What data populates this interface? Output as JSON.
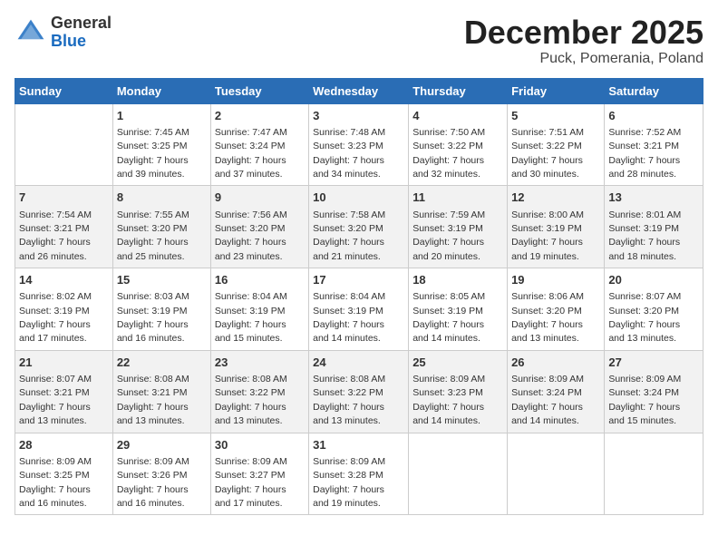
{
  "header": {
    "logo_general": "General",
    "logo_blue": "Blue",
    "title": "December 2025",
    "subtitle": "Puck, Pomerania, Poland"
  },
  "days_of_week": [
    "Sunday",
    "Monday",
    "Tuesday",
    "Wednesday",
    "Thursday",
    "Friday",
    "Saturday"
  ],
  "weeks": [
    [
      {
        "day": "",
        "empty": true
      },
      {
        "day": "1",
        "sunrise": "Sunrise: 7:45 AM",
        "sunset": "Sunset: 3:25 PM",
        "daylight": "Daylight: 7 hours",
        "minutes": "and 39 minutes."
      },
      {
        "day": "2",
        "sunrise": "Sunrise: 7:47 AM",
        "sunset": "Sunset: 3:24 PM",
        "daylight": "Daylight: 7 hours",
        "minutes": "and 37 minutes."
      },
      {
        "day": "3",
        "sunrise": "Sunrise: 7:48 AM",
        "sunset": "Sunset: 3:23 PM",
        "daylight": "Daylight: 7 hours",
        "minutes": "and 34 minutes."
      },
      {
        "day": "4",
        "sunrise": "Sunrise: 7:50 AM",
        "sunset": "Sunset: 3:22 PM",
        "daylight": "Daylight: 7 hours",
        "minutes": "and 32 minutes."
      },
      {
        "day": "5",
        "sunrise": "Sunrise: 7:51 AM",
        "sunset": "Sunset: 3:22 PM",
        "daylight": "Daylight: 7 hours",
        "minutes": "and 30 minutes."
      },
      {
        "day": "6",
        "sunrise": "Sunrise: 7:52 AM",
        "sunset": "Sunset: 3:21 PM",
        "daylight": "Daylight: 7 hours",
        "minutes": "and 28 minutes."
      }
    ],
    [
      {
        "day": "7",
        "sunrise": "Sunrise: 7:54 AM",
        "sunset": "Sunset: 3:21 PM",
        "daylight": "Daylight: 7 hours",
        "minutes": "and 26 minutes."
      },
      {
        "day": "8",
        "sunrise": "Sunrise: 7:55 AM",
        "sunset": "Sunset: 3:20 PM",
        "daylight": "Daylight: 7 hours",
        "minutes": "and 25 minutes."
      },
      {
        "day": "9",
        "sunrise": "Sunrise: 7:56 AM",
        "sunset": "Sunset: 3:20 PM",
        "daylight": "Daylight: 7 hours",
        "minutes": "and 23 minutes."
      },
      {
        "day": "10",
        "sunrise": "Sunrise: 7:58 AM",
        "sunset": "Sunset: 3:20 PM",
        "daylight": "Daylight: 7 hours",
        "minutes": "and 21 minutes."
      },
      {
        "day": "11",
        "sunrise": "Sunrise: 7:59 AM",
        "sunset": "Sunset: 3:19 PM",
        "daylight": "Daylight: 7 hours",
        "minutes": "and 20 minutes."
      },
      {
        "day": "12",
        "sunrise": "Sunrise: 8:00 AM",
        "sunset": "Sunset: 3:19 PM",
        "daylight": "Daylight: 7 hours",
        "minutes": "and 19 minutes."
      },
      {
        "day": "13",
        "sunrise": "Sunrise: 8:01 AM",
        "sunset": "Sunset: 3:19 PM",
        "daylight": "Daylight: 7 hours",
        "minutes": "and 18 minutes."
      }
    ],
    [
      {
        "day": "14",
        "sunrise": "Sunrise: 8:02 AM",
        "sunset": "Sunset: 3:19 PM",
        "daylight": "Daylight: 7 hours",
        "minutes": "and 17 minutes."
      },
      {
        "day": "15",
        "sunrise": "Sunrise: 8:03 AM",
        "sunset": "Sunset: 3:19 PM",
        "daylight": "Daylight: 7 hours",
        "minutes": "and 16 minutes."
      },
      {
        "day": "16",
        "sunrise": "Sunrise: 8:04 AM",
        "sunset": "Sunset: 3:19 PM",
        "daylight": "Daylight: 7 hours",
        "minutes": "and 15 minutes."
      },
      {
        "day": "17",
        "sunrise": "Sunrise: 8:04 AM",
        "sunset": "Sunset: 3:19 PM",
        "daylight": "Daylight: 7 hours",
        "minutes": "and 14 minutes."
      },
      {
        "day": "18",
        "sunrise": "Sunrise: 8:05 AM",
        "sunset": "Sunset: 3:19 PM",
        "daylight": "Daylight: 7 hours",
        "minutes": "and 14 minutes."
      },
      {
        "day": "19",
        "sunrise": "Sunrise: 8:06 AM",
        "sunset": "Sunset: 3:20 PM",
        "daylight": "Daylight: 7 hours",
        "minutes": "and 13 minutes."
      },
      {
        "day": "20",
        "sunrise": "Sunrise: 8:07 AM",
        "sunset": "Sunset: 3:20 PM",
        "daylight": "Daylight: 7 hours",
        "minutes": "and 13 minutes."
      }
    ],
    [
      {
        "day": "21",
        "sunrise": "Sunrise: 8:07 AM",
        "sunset": "Sunset: 3:21 PM",
        "daylight": "Daylight: 7 hours",
        "minutes": "and 13 minutes."
      },
      {
        "day": "22",
        "sunrise": "Sunrise: 8:08 AM",
        "sunset": "Sunset: 3:21 PM",
        "daylight": "Daylight: 7 hours",
        "minutes": "and 13 minutes."
      },
      {
        "day": "23",
        "sunrise": "Sunrise: 8:08 AM",
        "sunset": "Sunset: 3:22 PM",
        "daylight": "Daylight: 7 hours",
        "minutes": "and 13 minutes."
      },
      {
        "day": "24",
        "sunrise": "Sunrise: 8:08 AM",
        "sunset": "Sunset: 3:22 PM",
        "daylight": "Daylight: 7 hours",
        "minutes": "and 13 minutes."
      },
      {
        "day": "25",
        "sunrise": "Sunrise: 8:09 AM",
        "sunset": "Sunset: 3:23 PM",
        "daylight": "Daylight: 7 hours",
        "minutes": "and 14 minutes."
      },
      {
        "day": "26",
        "sunrise": "Sunrise: 8:09 AM",
        "sunset": "Sunset: 3:24 PM",
        "daylight": "Daylight: 7 hours",
        "minutes": "and 14 minutes."
      },
      {
        "day": "27",
        "sunrise": "Sunrise: 8:09 AM",
        "sunset": "Sunset: 3:24 PM",
        "daylight": "Daylight: 7 hours",
        "minutes": "and 15 minutes."
      }
    ],
    [
      {
        "day": "28",
        "sunrise": "Sunrise: 8:09 AM",
        "sunset": "Sunset: 3:25 PM",
        "daylight": "Daylight: 7 hours",
        "minutes": "and 16 minutes."
      },
      {
        "day": "29",
        "sunrise": "Sunrise: 8:09 AM",
        "sunset": "Sunset: 3:26 PM",
        "daylight": "Daylight: 7 hours",
        "minutes": "and 16 minutes."
      },
      {
        "day": "30",
        "sunrise": "Sunrise: 8:09 AM",
        "sunset": "Sunset: 3:27 PM",
        "daylight": "Daylight: 7 hours",
        "minutes": "and 17 minutes."
      },
      {
        "day": "31",
        "sunrise": "Sunrise: 8:09 AM",
        "sunset": "Sunset: 3:28 PM",
        "daylight": "Daylight: 7 hours",
        "minutes": "and 19 minutes."
      },
      {
        "day": "",
        "empty": true
      },
      {
        "day": "",
        "empty": true
      },
      {
        "day": "",
        "empty": true
      }
    ]
  ]
}
